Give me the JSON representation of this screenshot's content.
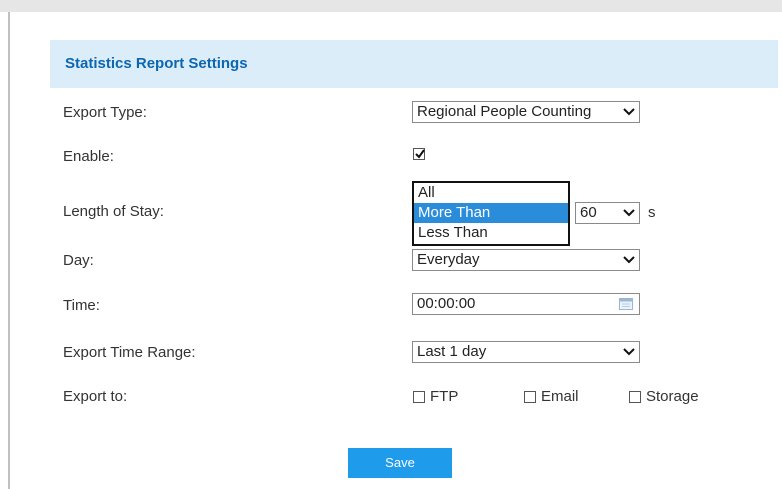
{
  "panel": {
    "title": "Statistics Report Settings"
  },
  "fields": {
    "export_type": {
      "label": "Export Type:",
      "value": "Regional People Counting"
    },
    "enable": {
      "label": "Enable:",
      "checked": true
    },
    "length_of_stay": {
      "label": "Length of Stay:",
      "options": [
        "All",
        "More Than",
        "Less Than"
      ],
      "selected": "More Than",
      "seconds_value": "60",
      "unit": "s"
    },
    "day": {
      "label": "Day:",
      "value": "Everyday"
    },
    "time": {
      "label": "Time:",
      "value": "00:00:00"
    },
    "export_time_range": {
      "label": "Export Time Range:",
      "value": "Last 1 day"
    },
    "export_to": {
      "label": "Export to:",
      "options": [
        {
          "label": "FTP",
          "checked": false
        },
        {
          "label": "Email",
          "checked": false
        },
        {
          "label": "Storage",
          "checked": false
        }
      ]
    }
  },
  "actions": {
    "save_label": "Save"
  },
  "colors": {
    "header_bg": "#dcedfa",
    "header_text": "#0c67b1",
    "highlight": "#2b8cd9",
    "save_button": "#1e9ceb"
  }
}
